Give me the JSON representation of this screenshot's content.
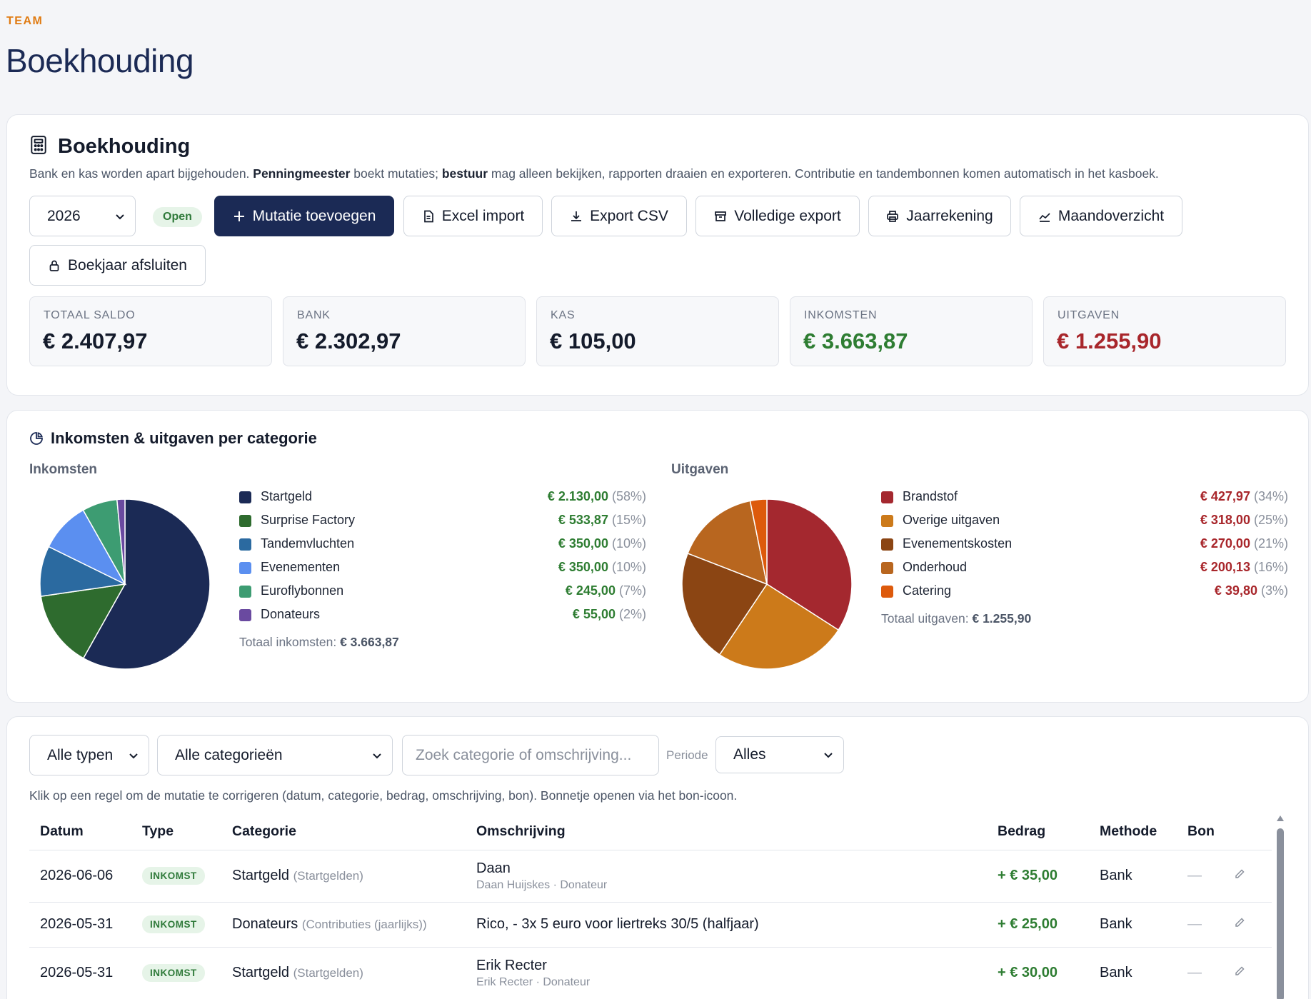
{
  "eyebrow": "TEAM",
  "page_title": "Boekhouding",
  "main": {
    "title": "Boekhouding",
    "desc_1": "Bank en kas worden apart bijgehouden. ",
    "desc_b1": "Penningmeester",
    "desc_2": " boekt mutaties; ",
    "desc_b2": "bestuur",
    "desc_3": " mag alleen bekijken, rapporten draaien en exporteren. Contributie en tandembonnen komen automatisch in het kasboek.",
    "year": "2026",
    "status": "Open",
    "buttons": {
      "add": "Mutatie toevoegen",
      "excel": "Excel import",
      "csv": "Export CSV",
      "full": "Volledige export",
      "annual": "Jaarrekening",
      "monthly": "Maandoverzicht",
      "close": "Boekjaar afsluiten"
    },
    "stats": [
      {
        "label": "TOTAAL SALDO",
        "value": "€ 2.407,97"
      },
      {
        "label": "BANK",
        "value": "€ 2.302,97"
      },
      {
        "label": "KAS",
        "value": "€ 105,00"
      },
      {
        "label": "INKOMSTEN",
        "value": "€ 3.663,87"
      },
      {
        "label": "UITGAVEN",
        "value": "€ 1.255,90"
      }
    ]
  },
  "charts": {
    "title": "Inkomsten & uitgaven per categorie",
    "income_label": "Inkomsten",
    "expense_label": "Uitgaven",
    "income_total_label": "Totaal inkomsten:",
    "income_total": "€ 3.663,87",
    "expense_total_label": "Totaal uitgaven:",
    "expense_total": "€ 1.255,90",
    "income_amount_color": "#2e7d32",
    "expense_amount_color": "#a8262b"
  },
  "chart_data": [
    {
      "type": "pie",
      "title": "Inkomsten",
      "categories": [
        "Startgeld",
        "Surprise Factory",
        "Tandemvluchten",
        "Evenementen",
        "Euroflybonnen",
        "Donateurs"
      ],
      "values": [
        2130.0,
        533.87,
        350.0,
        350.0,
        245.0,
        55.0
      ],
      "labels": [
        "€ 2.130,00",
        "€ 533,87",
        "€ 350,00",
        "€ 350,00",
        "€ 245,00",
        "€ 55,00"
      ],
      "percents": [
        "(58%)",
        "(15%)",
        "(10%)",
        "(10%)",
        "(7%)",
        "(2%)"
      ],
      "colors": [
        "#1b2a55",
        "#2e6b2e",
        "#2b6aa0",
        "#5b8ff0",
        "#3d9c72",
        "#6a4aa0"
      ]
    },
    {
      "type": "pie",
      "title": "Uitgaven",
      "categories": [
        "Brandstof",
        "Overige uitgaven",
        "Evenementskosten",
        "Onderhoud",
        "Catering"
      ],
      "values": [
        427.97,
        318.0,
        270.0,
        200.13,
        39.8
      ],
      "labels": [
        "€ 427,97",
        "€ 318,00",
        "€ 270,00",
        "€ 200,13",
        "€ 39,80"
      ],
      "percents": [
        "(34%)",
        "(25%)",
        "(21%)",
        "(16%)",
        "(3%)"
      ],
      "colors": [
        "#a4282f",
        "#cc7a1a",
        "#8b4513",
        "#b8661f",
        "#dd5a0c"
      ]
    }
  ],
  "filters": {
    "type": "Alle typen",
    "category": "Alle categorieën",
    "search_placeholder": "Zoek categorie of omschrijving...",
    "period_label": "Periode",
    "period": "Alles",
    "hint": "Klik op een regel om de mutatie te corrigeren (datum, categorie, bedrag, omschrijving, bon). Bonnetje openen via het bon-icoon."
  },
  "table": {
    "headers": [
      "Datum",
      "Type",
      "Categorie",
      "Omschrijving",
      "Bedrag",
      "Methode",
      "Bon"
    ],
    "rows": [
      {
        "date": "2026-06-06",
        "type": "INKOMST",
        "category": "Startgeld",
        "category_sub": "(Startgelden)",
        "desc": "Daan",
        "desc_sub": "Daan Huijskes · Donateur",
        "amount": "+ € 35,00",
        "method": "Bank",
        "bon": "—"
      },
      {
        "date": "2026-05-31",
        "type": "INKOMST",
        "category": "Donateurs",
        "category_sub": "(Contributies (jaarlijks))",
        "desc": "Rico, - 3x 5 euro voor liertreks 30/5 (halfjaar)",
        "desc_sub": "",
        "amount": "+ € 25,00",
        "method": "Bank",
        "bon": "—"
      },
      {
        "date": "2026-05-31",
        "type": "INKOMST",
        "category": "Startgeld",
        "category_sub": "(Startgelden)",
        "desc": "Erik Recter",
        "desc_sub": "Erik Recter · Donateur",
        "amount": "+ € 30,00",
        "method": "Bank",
        "bon": "—"
      }
    ]
  }
}
